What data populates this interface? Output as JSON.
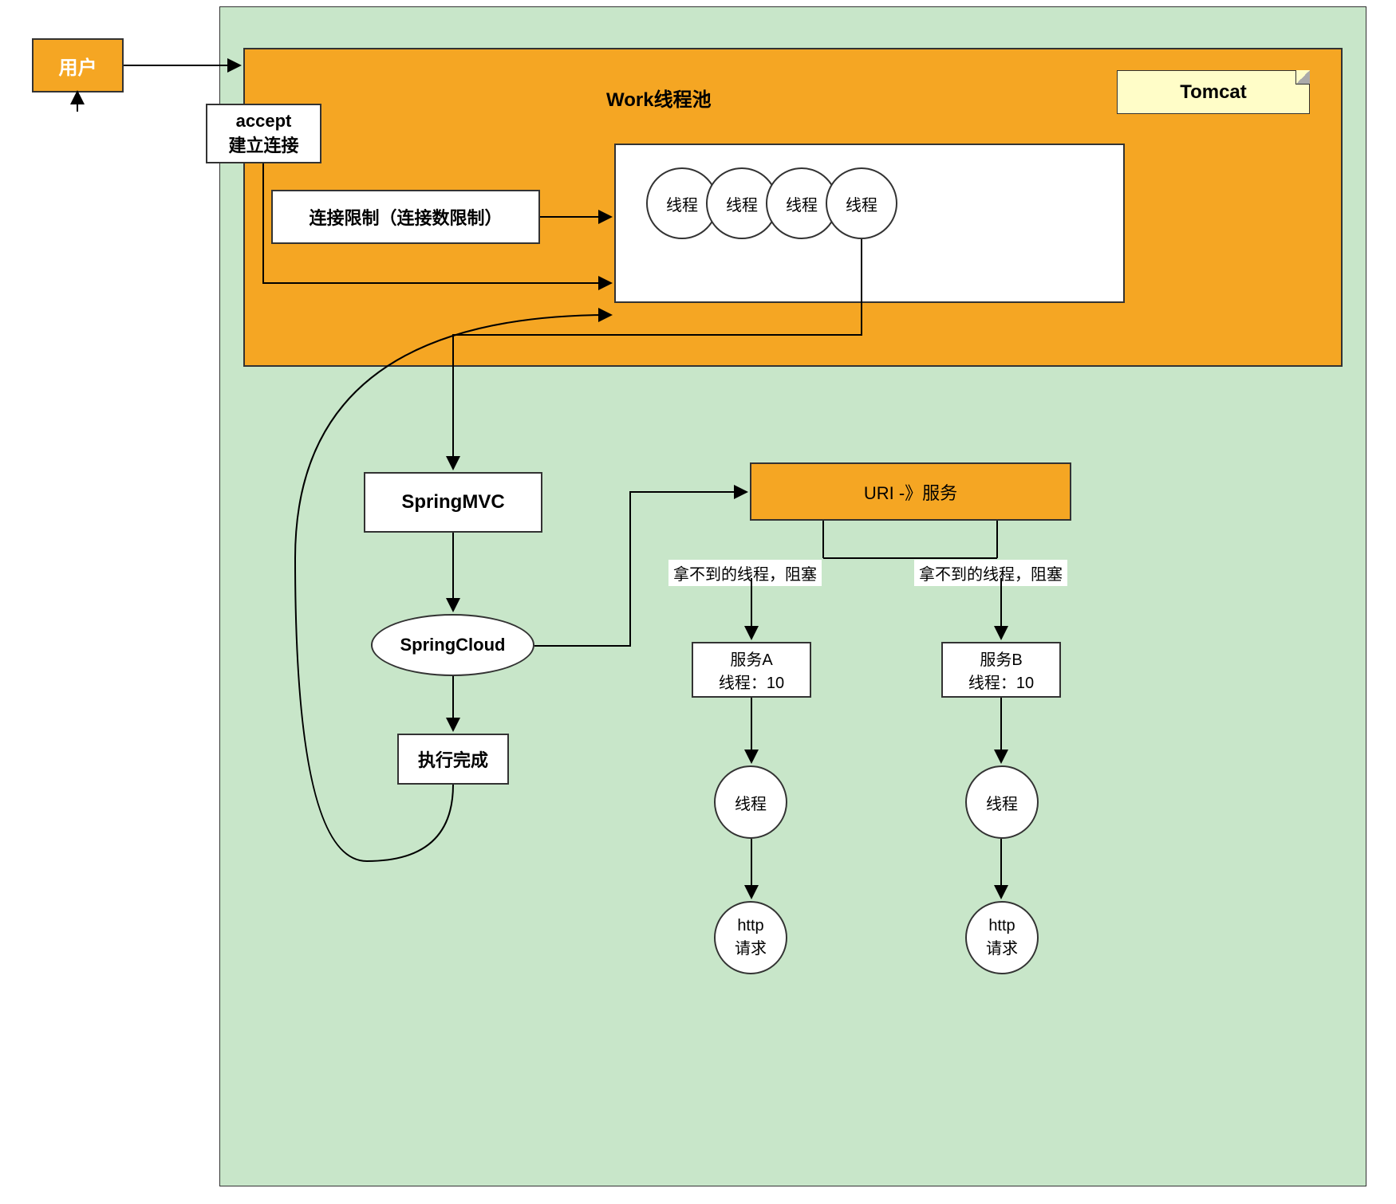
{
  "nodes": {
    "user": "用户",
    "accept": "accept\n建立连接",
    "threadpool_title": "Work线程池",
    "tomcat_note": "Tomcat",
    "connection_limit": "连接限制（连接数限制）",
    "thread1": "线程",
    "thread2": "线程",
    "thread3": "线程",
    "thread4": "线程",
    "springmvc": "SpringMVC",
    "springcloud": "SpringCloud",
    "done": "执行完成",
    "uri_service": "URI -》服务",
    "blockA": "拿不到的线程，阻塞",
    "blockB": "拿不到的线程，阻塞",
    "serviceA_line1": "服务A",
    "serviceA_line2": "线程：10",
    "serviceB_line1": "服务B",
    "serviceB_line2": "线程：10",
    "threadA": "线程",
    "threadB": "线程",
    "httpA": "http\n请求",
    "httpB": "http\n请求"
  },
  "colors": {
    "green": "#c8e6c9",
    "orange": "#f5a623",
    "note": "#fffdc8"
  }
}
